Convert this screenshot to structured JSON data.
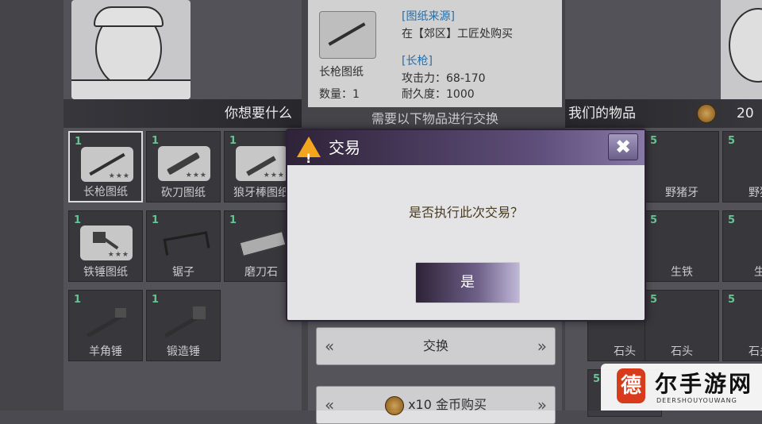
{
  "left_panel": {
    "header": "你想要什么",
    "slots": [
      {
        "count": "1",
        "name": "长枪图纸",
        "stars": "★★★",
        "icon": "spear-blueprint-icon"
      },
      {
        "count": "1",
        "name": "砍刀图纸",
        "stars": "★★★",
        "icon": "machete-blueprint-icon"
      },
      {
        "count": "1",
        "name": "狼牙棒图纸",
        "stars": "★★★",
        "icon": "mace-blueprint-icon"
      },
      {
        "count": "1",
        "name": "铁锤图纸",
        "stars": "★★★",
        "icon": "hammer-blueprint-icon"
      },
      {
        "count": "1",
        "name": "锯子",
        "icon": "saw-icon"
      },
      {
        "count": "1",
        "name": "磨刀石",
        "icon": "whetstone-icon"
      },
      {
        "count": "1",
        "name": "羊角锤",
        "icon": "claw-hammer-icon"
      },
      {
        "count": "1",
        "name": "锻造锤",
        "icon": "forging-hammer-icon"
      }
    ]
  },
  "center_panel": {
    "source_label": "[图纸来源]",
    "source_text": "在【郊区】工匠处购买",
    "item_label": "[长枪]",
    "attack": "攻击力：68-170",
    "durability": "耐久度：1000",
    "item_name": "长枪图纸",
    "quantity": "数量：1",
    "need_text": "需要以下物品进行交换",
    "exchange_button": "交换",
    "buy_button": "x10 金币购买",
    "left_chevrons": "«",
    "right_chevrons": "»"
  },
  "right_panel": {
    "header": "我们的物品",
    "coins": "20",
    "slots": [
      {
        "count": "5",
        "name": "野猪牙"
      },
      {
        "count": "5",
        "name": "野猪"
      },
      {
        "count": "5",
        "name": "生铁"
      },
      {
        "count": "5",
        "name": "生"
      },
      {
        "count": "5",
        "name": "石头"
      },
      {
        "count": "5",
        "name": "石头"
      },
      {
        "count": "5",
        "name": "石头"
      },
      {
        "count": "5",
        "name": ""
      }
    ]
  },
  "dialog": {
    "title": "交易",
    "message": "是否执行此次交易？",
    "confirm": "是",
    "close": "✖"
  },
  "watermark": {
    "seal": "德",
    "brand": "尔手游网",
    "sub": "DEERSHOUYOUWANG"
  },
  "colors": {
    "count_green": "#6fd5a0",
    "dialog_titlebar": "#5e4e7a",
    "warning": "#f3a51e",
    "info_blue": "#2f76b0"
  }
}
